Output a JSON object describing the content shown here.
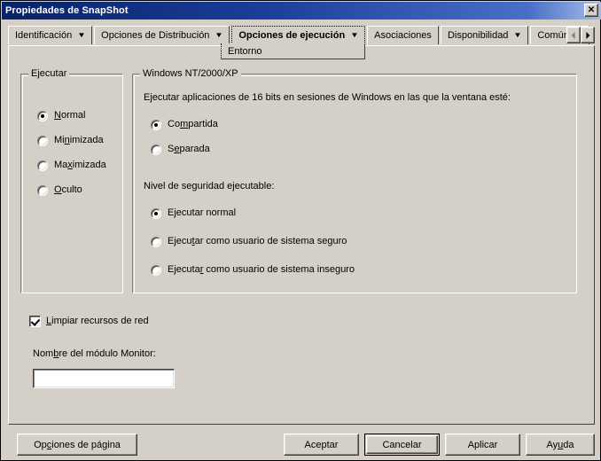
{
  "window": {
    "title": "Propiedades de SnapShot",
    "close_label": "✕",
    "close_icon": "close-icon"
  },
  "tabs": {
    "items": [
      {
        "label": "Identificación",
        "has_dropdown": true,
        "active": false
      },
      {
        "label": "Opciones de Distribución",
        "has_dropdown": true,
        "active": false
      },
      {
        "label": "Opciones de ejecución",
        "has_dropdown": true,
        "active": true
      },
      {
        "label": "Asociaciones",
        "has_dropdown": false,
        "active": false
      },
      {
        "label": "Disponibilidad",
        "has_dropdown": true,
        "active": false
      },
      {
        "label": "Común",
        "has_dropdown": true,
        "active": false
      }
    ],
    "dropdown_caret": "▼",
    "active_subtab": "Entorno",
    "scroll_left_label": "◄",
    "scroll_right_label": "►"
  },
  "ejecutar_group": {
    "title": "Ejecutar",
    "options": [
      {
        "label": "Normal",
        "accel_index": 0,
        "checked": true
      },
      {
        "label": "Minimizada",
        "accel_index": 2,
        "checked": false
      },
      {
        "label": "Maximizada",
        "accel_index": 3,
        "checked": false
      },
      {
        "label": "Oculto",
        "accel_index": 0,
        "checked": false
      }
    ]
  },
  "winnt_group": {
    "title": "Windows NT/2000/XP",
    "window_state_prompt": "Ejecutar aplicaciones de 16 bits en sesiones de Windows en las que la ventana esté:",
    "window_state_options": [
      {
        "label": "Compartida",
        "accel_index": 2,
        "checked": true
      },
      {
        "label": "Separada",
        "accel_index": 1,
        "checked": false
      }
    ],
    "security_prompt": "Nivel de seguridad ejecutable:",
    "security_options": [
      {
        "label": "Ejecutar normal",
        "accel_index": 1,
        "checked": true
      },
      {
        "label": "Ejecutar como usuario de sistema seguro",
        "accel_index": 6,
        "checked": false
      },
      {
        "label": "Ejecutar como usuario de sistema inseguro",
        "accel_index": 7,
        "checked": false
      }
    ]
  },
  "cleanup": {
    "label": "Limpiar recursos de red",
    "accel_index": 0,
    "checked": true
  },
  "monitor_module": {
    "label": "Nombre del módulo Monitor:",
    "accel_index": 3,
    "value": "",
    "placeholder": ""
  },
  "footer": {
    "page_options": {
      "label": "Opciones de página",
      "accel_index": 3
    },
    "ok": {
      "label": "Aceptar",
      "accel_index": -1
    },
    "cancel": {
      "label": "Cancelar",
      "accel_index": -1,
      "is_default": true
    },
    "apply": {
      "label": "Aplicar",
      "accel_index": -1
    },
    "help": {
      "label": "Ayuda",
      "accel_index": 2
    }
  },
  "colors": {
    "face": "#d4d0c8",
    "title_start": "#0a246a",
    "title_end": "#a6bbe8",
    "text": "#000000",
    "field_bg": "#ffffff"
  }
}
